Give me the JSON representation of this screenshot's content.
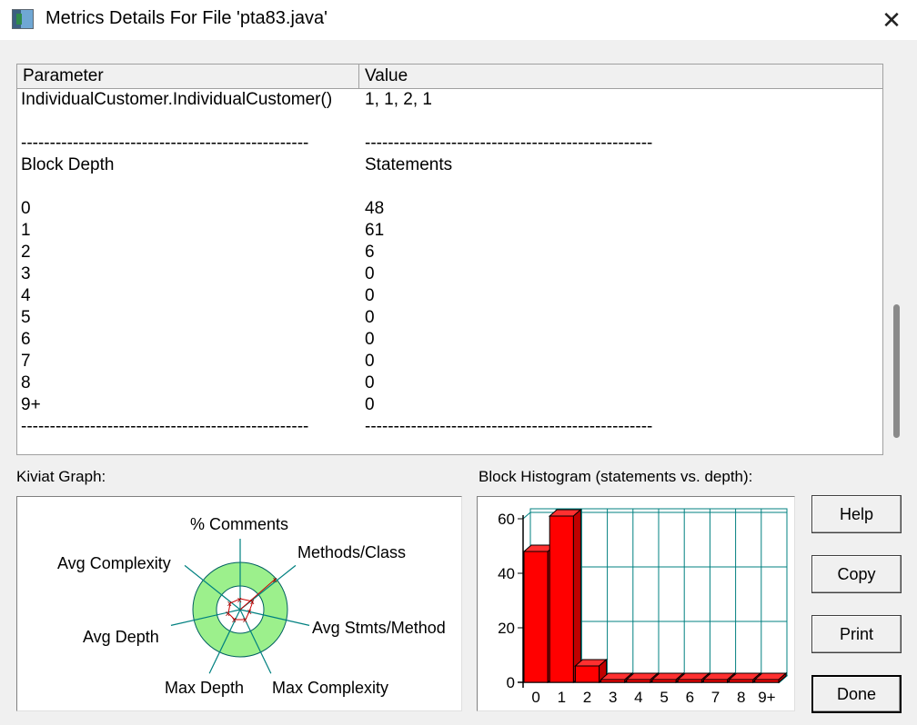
{
  "window": {
    "title": "Metrics Details For File 'pta83.java'",
    "close_icon": "close-icon"
  },
  "table": {
    "headers": {
      "parameter": "Parameter",
      "value": "Value"
    },
    "rows": [
      {
        "param": "IndividualCustomer.IndividualCustomer()",
        "value": "1, 1, 2, 1"
      },
      {
        "param": "",
        "value": ""
      },
      {
        "param": "--------------------------------------------------",
        "value": "--------------------------------------------------"
      },
      {
        "param": "Block Depth",
        "value": "Statements"
      },
      {
        "param": "",
        "value": ""
      },
      {
        "param": "0",
        "value": "48"
      },
      {
        "param": "1",
        "value": "61"
      },
      {
        "param": "2",
        "value": "6"
      },
      {
        "param": "3",
        "value": "0"
      },
      {
        "param": "4",
        "value": "0"
      },
      {
        "param": "5",
        "value": "0"
      },
      {
        "param": "6",
        "value": "0"
      },
      {
        "param": "7",
        "value": "0"
      },
      {
        "param": "8",
        "value": "0"
      },
      {
        "param": "9+",
        "value": "0"
      },
      {
        "param": "--------------------------------------------------",
        "value": "--------------------------------------------------"
      }
    ]
  },
  "kiviat": {
    "label": "Kiviat Graph:",
    "axes": [
      "% Comments",
      "Methods/Class",
      "Avg Stmts/Method",
      "Max Complexity",
      "Max Depth",
      "Avg Depth",
      "Avg Complexity"
    ]
  },
  "histogram": {
    "label": "Block Histogram (statements vs. depth):"
  },
  "chart_data": {
    "type": "bar",
    "title": "Block Histogram (statements vs. depth):",
    "categories": [
      "0",
      "1",
      "2",
      "3",
      "4",
      "5",
      "6",
      "7",
      "8",
      "9+"
    ],
    "values": [
      48,
      61,
      6,
      0,
      0,
      0,
      0,
      0,
      0,
      0
    ],
    "ylim": [
      0,
      60
    ],
    "yticks": [
      "0",
      "20",
      "40",
      "60"
    ],
    "grid": true,
    "bar_color": "#ff0000"
  },
  "buttons": {
    "help": "Help",
    "copy": "Copy",
    "print": "Print",
    "done": "Done"
  },
  "colors": {
    "kiviat_ring": "#9cf08c",
    "axis": "#008080",
    "bar": "#ff0000"
  }
}
